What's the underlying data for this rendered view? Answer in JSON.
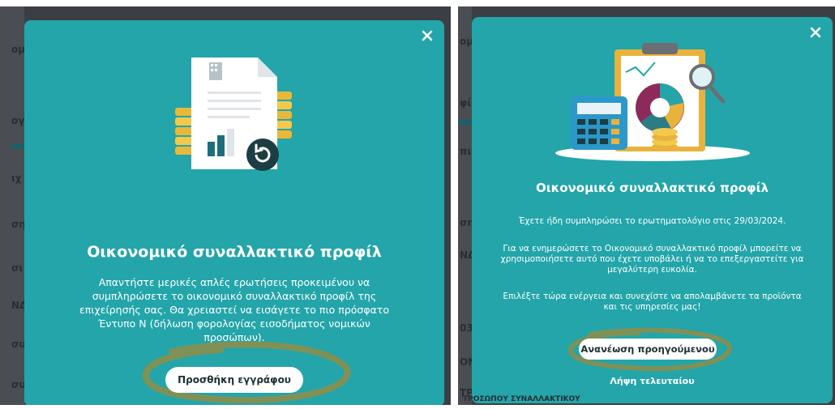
{
  "left_dialog": {
    "title": "Οικονομικό συναλλακτικό προφίλ",
    "body": "Απαντήστε μερικές απλές ερωτήσεις προκειμένου να συμπληρώσετε το οικονομικό συναλλακτικό προφίλ της επιχείρησής σας. Θα χρειαστεί να εισάγετε το πιο πρόσφατο Έντυπο Ν (δήλωση φορολογίας εισοδήματος νομικών προσώπων).",
    "primary_button": "Προσθήκη εγγράφου",
    "close_icon": "close-icon",
    "illustration": "document-refresh-illustration"
  },
  "right_dialog": {
    "title": "Οικονομικό συναλλακτικό προφίλ",
    "completed_text": "Έχετε ήδη συμπληρώσει το ερωτηματολόγιο στις 29/03/2024.",
    "update_text": "Για να ενημερώσετε το Οικονομικό συναλλακτικό προφίλ μπορείτε να χρησιμοποιήσετε αυτό που έχετε υποβάλει ή να το επεξεργαστείτε για μεγαλύτερη ευκολία.",
    "choose_text": "Επιλέξτε τώρα ενέργεια και συνεχίστε να απολαμβάνετε τα προϊόντα και τις υπηρεσίες μας!",
    "primary_button": "Ανανέωση προηγούμενου",
    "secondary_link": "Λήψη τελευταίου",
    "close_icon": "close-icon",
    "illustration": "calculator-clipboard-chart-illustration"
  },
  "background_left": {
    "fragments": [
      "ομ",
      "ογ",
      "ιχ",
      "ση",
      "σι",
      "ΝΔ",
      "συ",
      "συ"
    ]
  },
  "background_right": {
    "fragments": [
      "ομ",
      "φίλ",
      "πιχ",
      "ση",
      "ΝΔ",
      "03",
      "ΟΝ",
      "ΤΡ"
    ],
    "footer_fragment": "ΤΡΟΣΩΠΟΥ ΣΥΝΑΛΛΑΚΤΙΚΟΥ"
  },
  "colors": {
    "modal_bg": "#23a5aa",
    "button_bg": "#ffffff",
    "button_text": "#1c2f35",
    "annotation": "#8a8f4e"
  }
}
